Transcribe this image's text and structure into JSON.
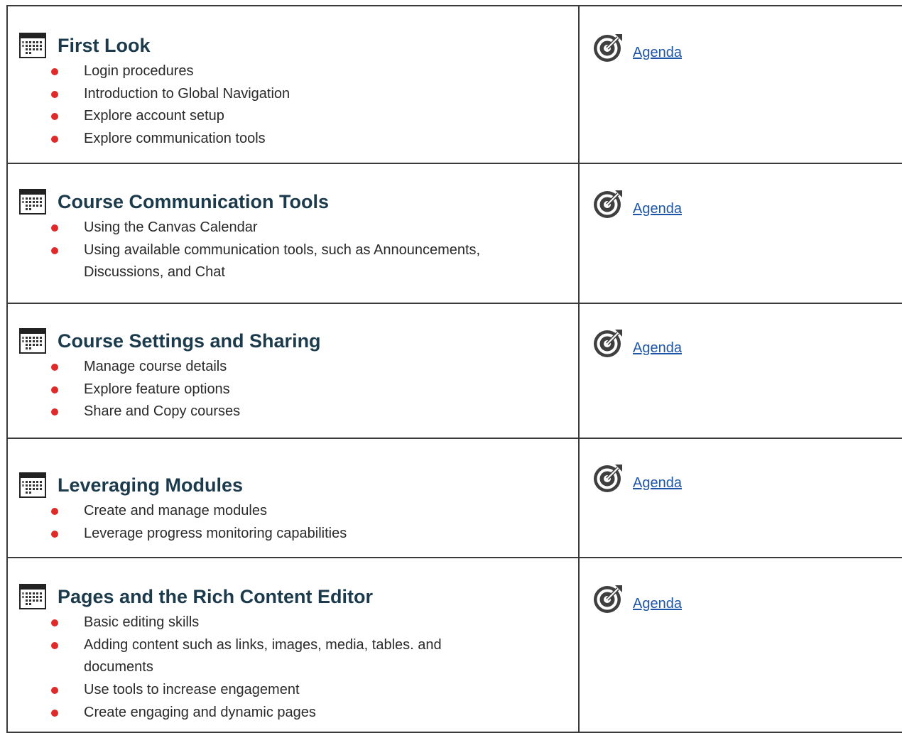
{
  "rows": [
    {
      "title": "First Look",
      "items": [
        "Login procedures",
        "Introduction to Global Navigation",
        "Explore account setup",
        "Explore communication tools"
      ],
      "link": "Agenda"
    },
    {
      "title": "Course Communication Tools",
      "items": [
        "Using the Canvas Calendar",
        "Using available communication tools, such as Announcements, Discussions, and Chat"
      ],
      "link": "Agenda"
    },
    {
      "title": "Course Settings and Sharing",
      "items": [
        "Manage course details",
        "Explore feature options",
        "Share and Copy courses"
      ],
      "link": "Agenda"
    },
    {
      "title": "Leveraging Modules",
      "items": [
        "Create and manage modules",
        "Leverage progress monitoring capabilities"
      ],
      "link": "Agenda"
    },
    {
      "title": "Pages and the Rich Content Editor",
      "items": [
        "Basic editing skills",
        "Adding content such as links, images, media, tables. and documents",
        "Use tools to increase engagement",
        "Create engaging and dynamic pages"
      ],
      "link": "Agenda"
    }
  ],
  "colors": {
    "title": "#1b3a4b",
    "bullet": "#e02a2a",
    "link": "#1f55a8",
    "border": "#3a3a3a"
  },
  "icons": {
    "section": "calendar-icon",
    "link": "target-icon"
  }
}
